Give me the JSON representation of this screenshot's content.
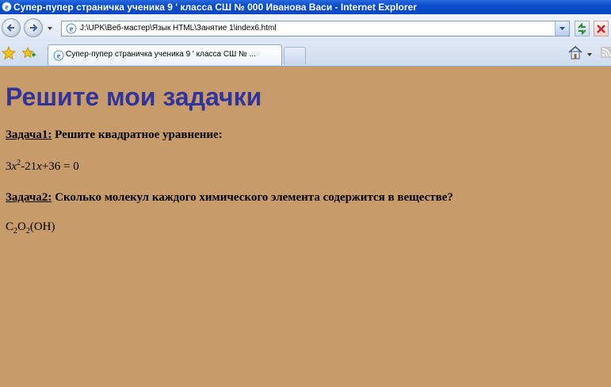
{
  "window": {
    "title": "Супер-пупер страничка ученика 9 ' класса СШ № 000 Иванова Васи - Internet Explorer"
  },
  "address_bar": {
    "url": "J:\\UPK\\Веб-мастер\\Язык HTML\\Занятие 1\\index6.html"
  },
  "tabs": [
    {
      "label": "Супер-пупер страничка ученика 9 ' класса СШ № ..."
    }
  ],
  "page": {
    "heading": "Решите мои задачки",
    "task1": {
      "label": "Задача1:",
      "text": " Решите квадратное уравнение:",
      "equation": {
        "coef_a": "3",
        "var1": "x",
        "power": "2",
        "middle": "-21",
        "var2": "x",
        "tail": "+36 = 0"
      }
    },
    "task2": {
      "label": "Задача2:",
      "text": " Сколько молекул каждого химического элемента содержится в веществе?",
      "formula": {
        "el1": "C",
        "sub1": "2",
        "el2": "O",
        "sub2": "2",
        "tail": "(OH)"
      }
    }
  },
  "colors": {
    "page_background": "#c79b6a",
    "heading": "#32349c",
    "titlebar": "#0a4cc8"
  }
}
